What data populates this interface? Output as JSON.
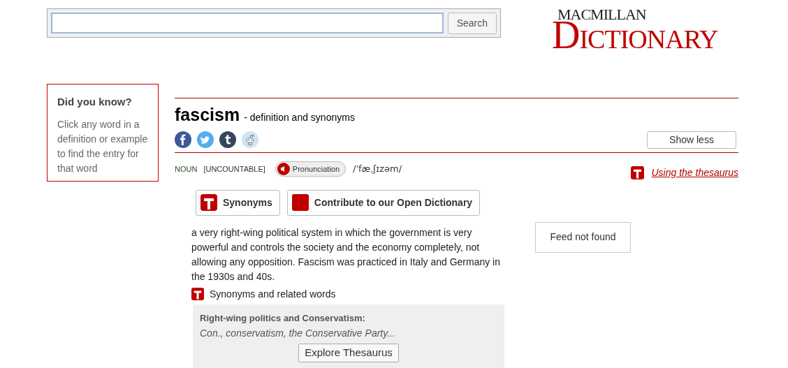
{
  "search": {
    "button": "Search"
  },
  "logo": {
    "top": "MACMILLAN",
    "bottom": "DICTIONARY"
  },
  "did_you_know": {
    "title": "Did you know?",
    "text": "Click any word in a definition or example to find the entry for that word"
  },
  "entry": {
    "headword": "fascism",
    "subtitle": "- definition and synonyms",
    "show_less": "Show less",
    "part_of_speech": "NOUN",
    "grammar": "[UNCOUNTABLE]",
    "pronunciation_button": "Pronunciation",
    "pronunciation": "/ˈfæˌʃɪzəm/",
    "thesaurus_link": "Using the thesaurus"
  },
  "share_icons": [
    {
      "kind": "facebook",
      "color": "#3b5998"
    },
    {
      "kind": "twitter",
      "color": "#55acee"
    },
    {
      "kind": "tumblr",
      "color": "#35465c"
    },
    {
      "kind": "reddit",
      "color": "#cee3f8"
    }
  ],
  "actions": [
    {
      "kind": "thesaurus",
      "label": "Synonyms"
    },
    {
      "kind": "square",
      "label": "Contribute to our Open Dictionary"
    }
  ],
  "definition": "a very right-wing political system in which the government is very powerful and controls the society and the economy completely, not allowing any opposition. Fascism was practiced in Italy and Germany in the 1930s and 40s.",
  "synonyms_heading": "Synonyms and related words",
  "thesaurus_box": {
    "title": "Right-wing politics and Conservatism:",
    "words": "Con., conservatism, the Conservative Party...",
    "button": "Explore Thesaurus"
  },
  "feed": "Feed not found"
}
